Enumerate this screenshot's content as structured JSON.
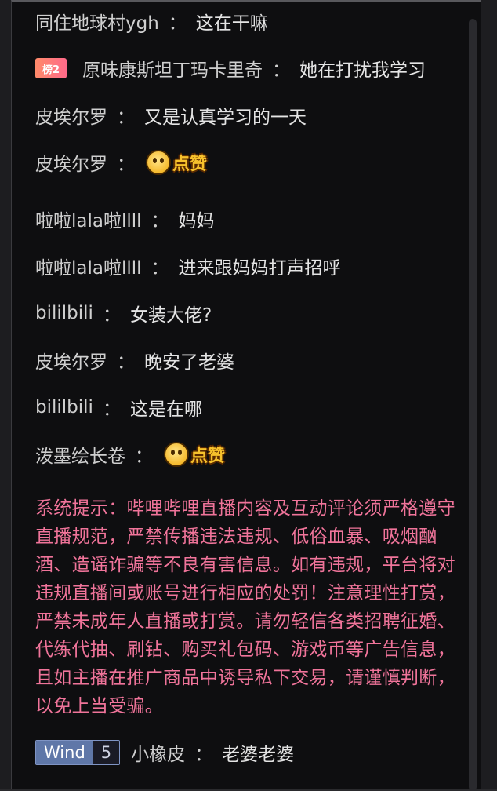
{
  "messages": [
    {
      "user": "同住地球村ygh",
      "sep": "：",
      "text": "这在干嘛"
    },
    {
      "badge": "榜2",
      "user": "原味康斯坦丁玛卡里奇",
      "sep": "：",
      "text": "她在打扰我学习"
    },
    {
      "user": "皮埃尔罗",
      "sep": "：",
      "text": "又是认真学习的一天"
    },
    {
      "user": "皮埃尔罗",
      "sep": "：",
      "emoji": "点赞"
    },
    {
      "user": "啦啦lala啦llll",
      "sep": "：",
      "text": "妈妈"
    },
    {
      "user": "啦啦lala啦llll",
      "sep": "：",
      "text": "进来跟妈妈打声招呼"
    },
    {
      "user": "bililbili",
      "sep": "：",
      "text": "女装大佬?"
    },
    {
      "user": "皮埃尔罗",
      "sep": "：",
      "text": "晚安了老婆"
    },
    {
      "user": "bililbili",
      "sep": "：",
      "text": "这是在哪"
    },
    {
      "user": "泼墨绘长卷",
      "sep": "：",
      "emoji": "点赞"
    },
    {
      "fan_badge": {
        "name": "Wind",
        "level": "5"
      },
      "user": "小橡皮",
      "sep": "：",
      "text": "老婆老婆"
    }
  ],
  "system_notice": "系统提示：哔哩哔哩直播内容及互动评论须严格遵守直播规范，严禁传播违法违规、低俗血暴、吸烟酗酒、造谣诈骗等不良有害信息。如有违规，平台将对违规直播间或账号进行相应的处罚！注意理性打赏，严禁未成年人直播或打赏。请勿轻信各类招聘征婚、代练代抽、刷钻、购买礼包码、游戏币等广告信息，且如主播在推广商品中诱导私下交易，请谨慎判断，以免上当受骗。"
}
